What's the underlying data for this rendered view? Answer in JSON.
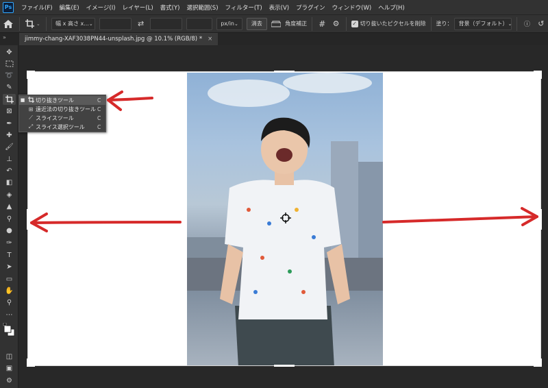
{
  "app": {
    "logo": "Ps"
  },
  "menu": [
    "ファイル(F)",
    "編集(E)",
    "イメージ(I)",
    "レイヤー(L)",
    "書式(Y)",
    "選択範囲(S)",
    "フィルター(T)",
    "表示(V)",
    "プラグイン",
    "ウィンドウ(W)",
    "ヘルプ(H)"
  ],
  "options": {
    "ratio_select": "幅 x 高さ x...",
    "unit_select": "px/in",
    "clear_label": "消去",
    "straighten_label": "角度補正",
    "delete_pixels_label": "切り抜いたピクセルを削除",
    "fill_label": "塗り：",
    "fill_select": "背景（デフォルト）"
  },
  "document": {
    "tab_title": "jimmy-chang-XAF3038PN44-unsplash.jpg @ 10.1% (RGB/8) *",
    "close_glyph": "×"
  },
  "flyout": {
    "items": [
      {
        "label": "切り抜きツール",
        "key": "C",
        "selected": true,
        "icon": "crop-icon"
      },
      {
        "label": "遠近法の切り抜きツール",
        "key": "C",
        "selected": false,
        "icon": "perspective-crop-icon"
      },
      {
        "label": "スライスツール",
        "key": "C",
        "selected": false,
        "icon": "slice-icon"
      },
      {
        "label": "スライス選択ツール",
        "key": "C",
        "selected": false,
        "icon": "slice-select-icon"
      }
    ]
  },
  "colors": {
    "annotation": "#d62a2a",
    "accent": "#31a8ff"
  }
}
